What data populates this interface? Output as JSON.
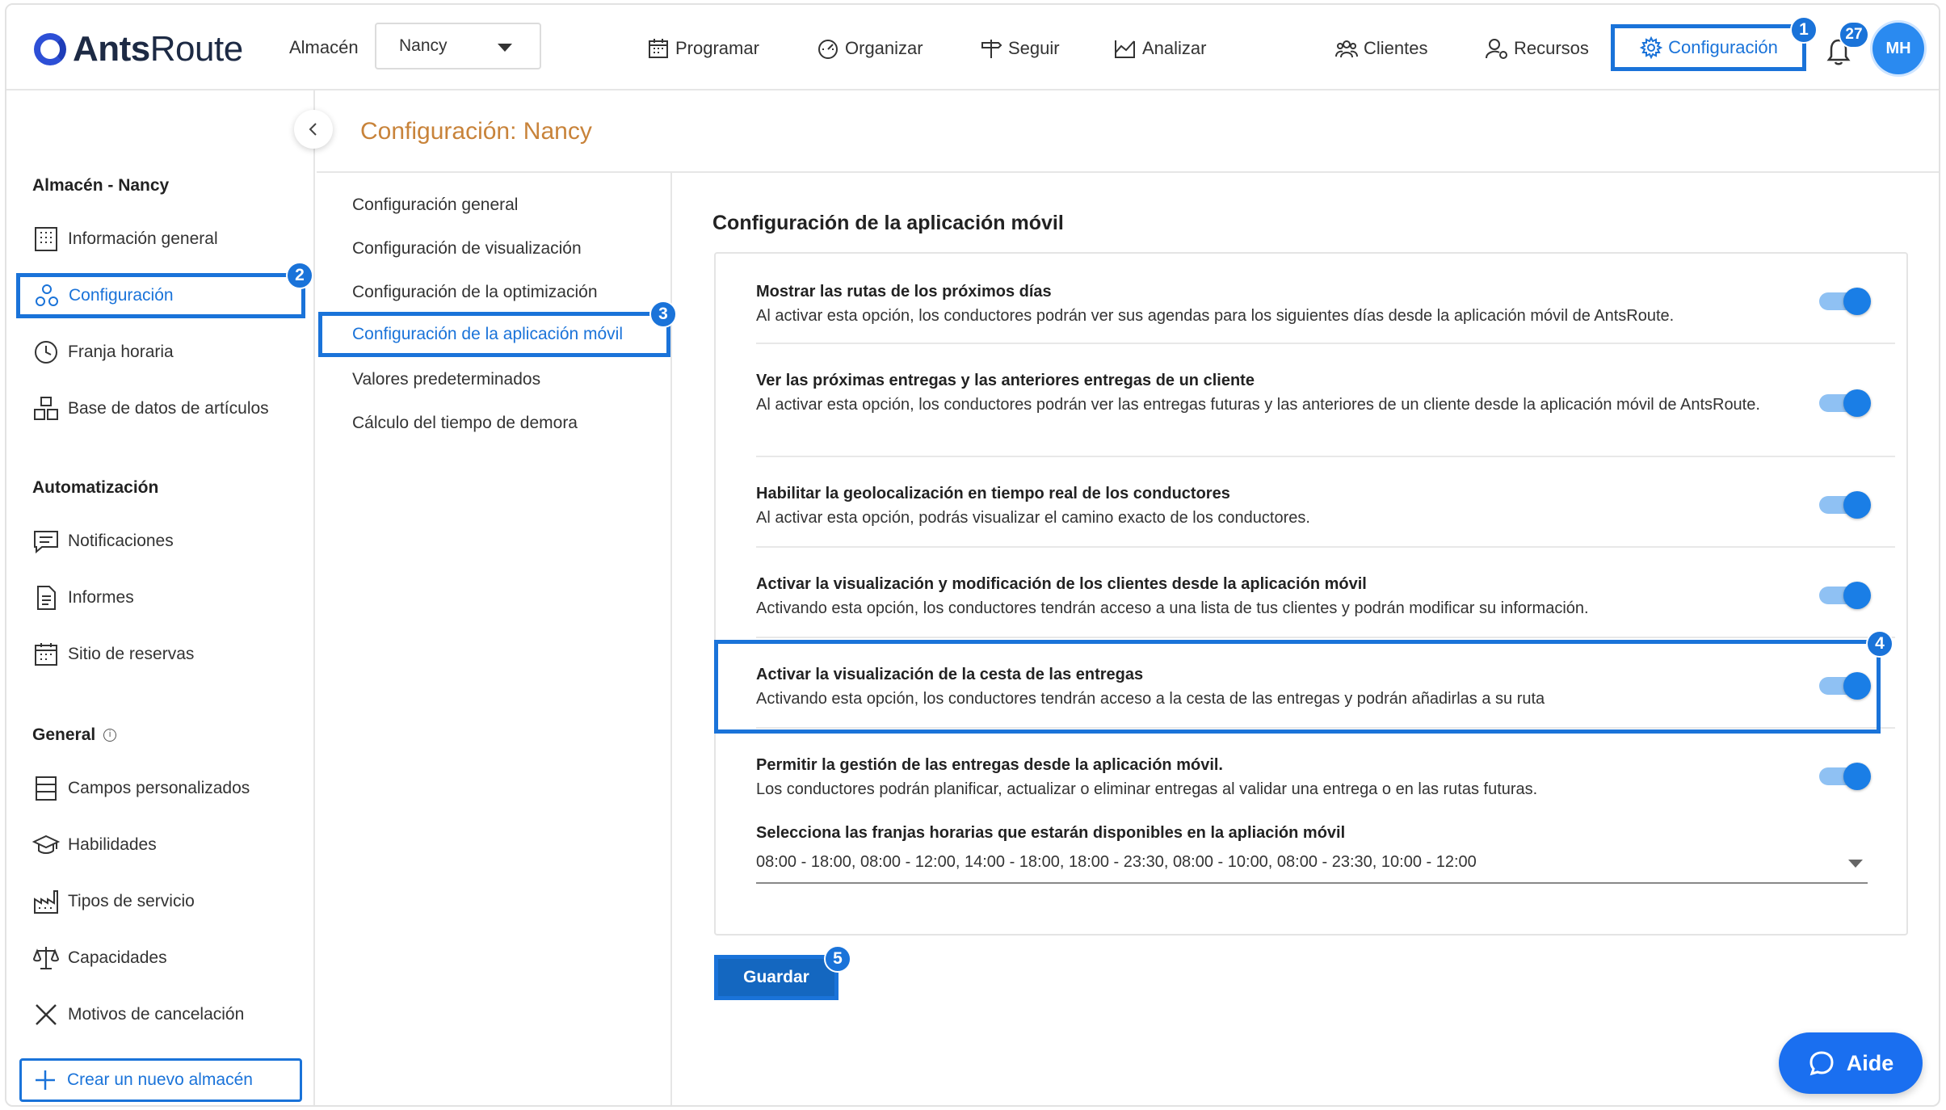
{
  "brand": {
    "name_bold": "Ants",
    "name_rest": "Route"
  },
  "header": {
    "warehouse_label": "Almacén",
    "warehouse_value": "Nancy",
    "nav": [
      "Programar",
      "Organizar",
      "Seguir",
      "Analizar",
      "Clientes",
      "Recursos",
      "Configuración"
    ],
    "notifications_count": "27",
    "avatar_initials": "MH"
  },
  "steps": [
    "1",
    "2",
    "3",
    "4",
    "5"
  ],
  "sidebar": {
    "section_warehouse": "Almacén - Nancy",
    "warehouse_items": [
      "Información general",
      "Configuración",
      "Franja horaria",
      "Base de datos de artículos"
    ],
    "section_automation": "Automatización",
    "automation_items": [
      "Notificaciones",
      "Informes",
      "Sitio de reservas"
    ],
    "section_general": "General",
    "general_items": [
      "Campos personalizados",
      "Habilidades",
      "Tipos de servicio",
      "Capacidades",
      "Motivos de cancelación"
    ],
    "create_button": "Crear un nuevo almacén"
  },
  "page_title": "Configuración: Nancy",
  "subnav": [
    "Configuración general",
    "Configuración de visualización",
    "Configuración de la optimización",
    "Configuración de la aplicación móvil",
    "Valores predeterminados",
    "Cálculo del tiempo de demora"
  ],
  "main": {
    "section_title": "Configuración de la aplicación móvil",
    "options": [
      {
        "title": "Mostrar las rutas de los próximos días",
        "desc": "Al activar esta opción, los conductores podrán ver sus agendas para los siguientes días desde la aplicación móvil de AntsRoute.",
        "enabled": true
      },
      {
        "title": "Ver las próximas entregas y las anteriores entregas de un cliente",
        "desc": "Al activar esta opción, los conductores podrán ver las entregas futuras y las anteriores de un cliente desde la aplicación móvil de AntsRoute.",
        "enabled": true
      },
      {
        "title": "Habilitar la geolocalización en tiempo real de los conductores",
        "desc": "Al activar esta opción, podrás visualizar el camino exacto de los conductores.",
        "enabled": true
      },
      {
        "title": "Activar la visualización y modificación de los clientes desde la aplicación móvil",
        "desc": "Activando esta opción, los conductores tendrán acceso a una lista de tus clientes y podrán modificar su información.",
        "enabled": true
      },
      {
        "title": "Activar la visualización de la cesta de las entregas",
        "desc": "Activando esta opción, los conductores tendrán acceso a la cesta de las entregas y podrán añadirlas a su ruta",
        "enabled": true
      },
      {
        "title": "Permitir la gestión de las entregas desde la aplicación móvil.",
        "desc": "Los conductores podrán planificar, actualizar o eliminar entregas al validar una entrega o en las rutas futuras.",
        "enabled": true
      }
    ],
    "slots_label": "Selecciona las franjas horarias que estarán disponibles en la apliación móvil",
    "slots_value": "08:00 - 18:00, 08:00 - 12:00, 14:00 - 18:00, 18:00 - 23:30, 08:00 - 10:00, 08:00 - 23:30, 10:00 - 12:00",
    "save_button": "Guardar"
  },
  "help_button": "Aide",
  "colors": {
    "accent": "#1a73d9",
    "title": "#c8833a",
    "toggle_on": "#1a7ee6"
  }
}
